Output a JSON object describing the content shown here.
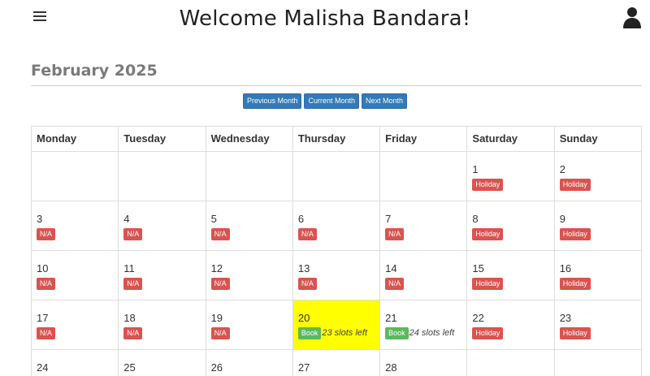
{
  "header": {
    "title": "Welcome Malisha Bandara!"
  },
  "calendar": {
    "month_label": "February 2025",
    "nav": {
      "previous": "Previous Month",
      "current": "Current Month",
      "next": "Next Month"
    },
    "weekdays": [
      "Monday",
      "Tuesday",
      "Wednesday",
      "Thursday",
      "Friday",
      "Saturday",
      "Sunday"
    ],
    "weeks": [
      [
        {
          "day": "",
          "status": ""
        },
        {
          "day": "",
          "status": ""
        },
        {
          "day": "",
          "status": ""
        },
        {
          "day": "",
          "status": ""
        },
        {
          "day": "",
          "status": ""
        },
        {
          "day": "1",
          "status": "Holiday",
          "color": "red"
        },
        {
          "day": "2",
          "status": "Holiday",
          "color": "red"
        }
      ],
      [
        {
          "day": "3",
          "status": "N/A",
          "color": "red"
        },
        {
          "day": "4",
          "status": "N/A",
          "color": "red"
        },
        {
          "day": "5",
          "status": "N/A",
          "color": "red"
        },
        {
          "day": "6",
          "status": "N/A",
          "color": "red"
        },
        {
          "day": "7",
          "status": "N/A",
          "color": "red"
        },
        {
          "day": "8",
          "status": "Holiday",
          "color": "red"
        },
        {
          "day": "9",
          "status": "Holiday",
          "color": "red"
        }
      ],
      [
        {
          "day": "10",
          "status": "N/A",
          "color": "red"
        },
        {
          "day": "11",
          "status": "N/A",
          "color": "red"
        },
        {
          "day": "12",
          "status": "N/A",
          "color": "red"
        },
        {
          "day": "13",
          "status": "N/A",
          "color": "red"
        },
        {
          "day": "14",
          "status": "N/A",
          "color": "red"
        },
        {
          "day": "15",
          "status": "Holiday",
          "color": "red"
        },
        {
          "day": "16",
          "status": "Holiday",
          "color": "red"
        }
      ],
      [
        {
          "day": "17",
          "status": "N/A",
          "color": "red"
        },
        {
          "day": "18",
          "status": "N/A",
          "color": "red"
        },
        {
          "day": "19",
          "status": "N/A",
          "color": "red"
        },
        {
          "day": "20",
          "status": "Book",
          "color": "green",
          "slots": "23 slots left",
          "today": true
        },
        {
          "day": "21",
          "status": "Book",
          "color": "green",
          "slots": "24 slots left"
        },
        {
          "day": "22",
          "status": "Holiday",
          "color": "red"
        },
        {
          "day": "23",
          "status": "Holiday",
          "color": "red"
        }
      ],
      [
        {
          "day": "24",
          "status": ""
        },
        {
          "day": "25",
          "status": ""
        },
        {
          "day": "26",
          "status": ""
        },
        {
          "day": "27",
          "status": ""
        },
        {
          "day": "28",
          "status": ""
        },
        {
          "day": "",
          "status": ""
        },
        {
          "day": "",
          "status": ""
        }
      ]
    ]
  },
  "colors": {
    "accent": "#337ab7",
    "danger": "#d9534f",
    "success": "#5cb85c",
    "today_highlight": "#ffff00",
    "heading_gray": "#7a7a7a"
  },
  "icons": {
    "menu": "hamburger-menu-icon",
    "user": "user-icon"
  }
}
